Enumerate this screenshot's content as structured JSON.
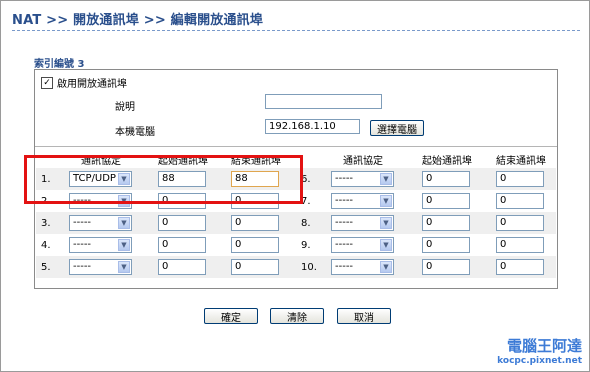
{
  "header": {
    "title": "NAT >> 開放通訊埠 >> 編輯開放通訊埠"
  },
  "index_label": "索引編號 3",
  "form": {
    "enable_label": "啟用開放通訊埠",
    "enable_checked": "✓",
    "comment_label": "說明",
    "comment_value": "",
    "local_pc_label": "本機電腦",
    "local_pc_value": "192.168.1.10",
    "select_pc_button": "選擇電腦"
  },
  "columns": {
    "protocol": "通訊協定",
    "start_port": "起始通訊埠",
    "end_port": "結束通訊埠"
  },
  "rows": [
    {
      "num": "1.",
      "protocol": "TCP/UDP",
      "start": "88",
      "end": "88"
    },
    {
      "num": "2.",
      "protocol": "-----",
      "start": "0",
      "end": "0"
    },
    {
      "num": "3.",
      "protocol": "-----",
      "start": "0",
      "end": "0"
    },
    {
      "num": "4.",
      "protocol": "-----",
      "start": "0",
      "end": "0"
    },
    {
      "num": "5.",
      "protocol": "-----",
      "start": "0",
      "end": "0"
    },
    {
      "num": "6.",
      "protocol": "-----",
      "start": "0",
      "end": "0"
    },
    {
      "num": "7.",
      "protocol": "-----",
      "start": "0",
      "end": "0"
    },
    {
      "num": "8.",
      "protocol": "-----",
      "start": "0",
      "end": "0"
    },
    {
      "num": "9.",
      "protocol": "-----",
      "start": "0",
      "end": "0"
    },
    {
      "num": "10.",
      "protocol": "-----",
      "start": "0",
      "end": "0"
    }
  ],
  "buttons": {
    "ok": "確定",
    "clear": "清除",
    "cancel": "取消"
  },
  "watermark": {
    "line1": "電腦王阿達",
    "line2": "kocpc.pixnet.net"
  },
  "colors": {
    "title": "#2a4f8c",
    "highlight": "#e31212"
  }
}
